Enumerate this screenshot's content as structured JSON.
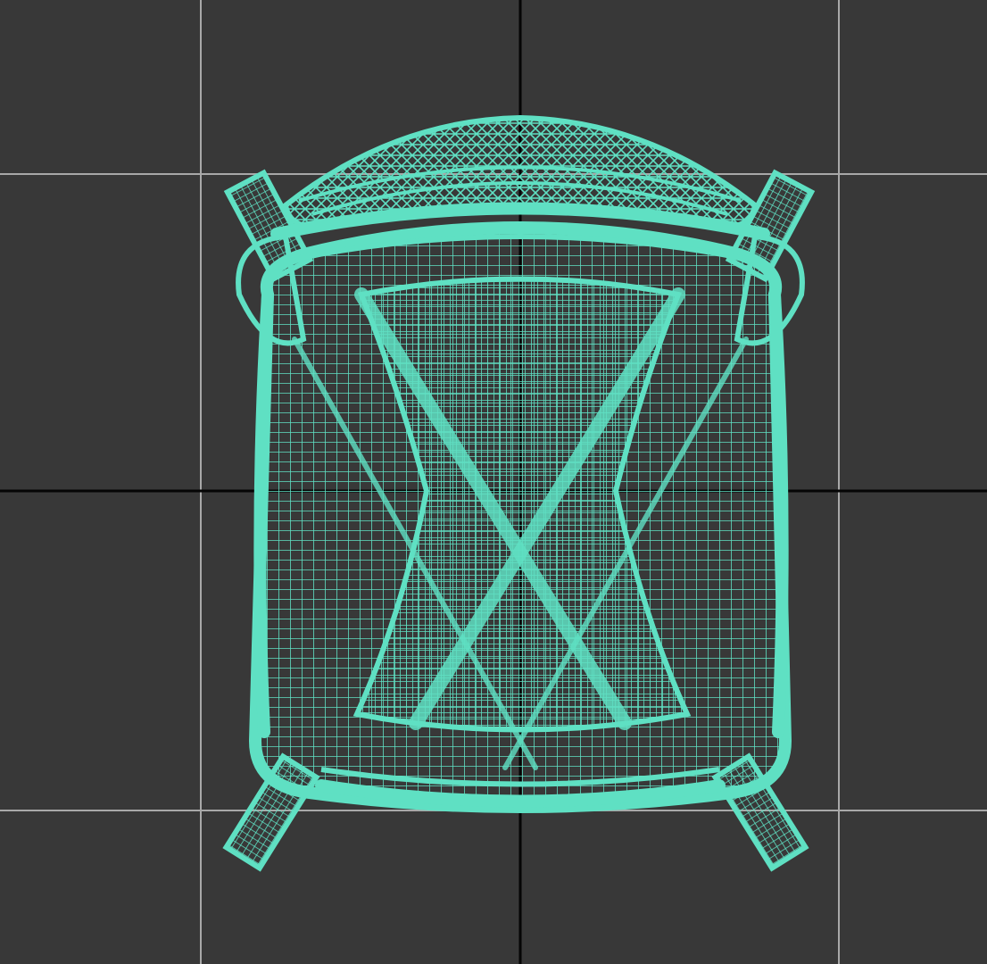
{
  "viewport": {
    "view": "top",
    "shading_mode": "wireframe",
    "grid_visible": true,
    "colors": {
      "background": "#383838",
      "grid_line": "#a8a8a8",
      "grid_axis": "#050505",
      "wireframe": "#5fe0c3"
    },
    "object": {
      "type": "armchair",
      "icon": "wireframe-armchair-icon",
      "leg_count": 4
    }
  }
}
